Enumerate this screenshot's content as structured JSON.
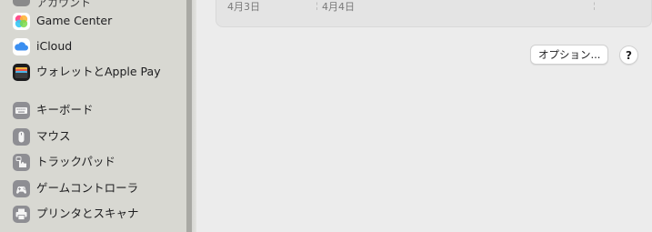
{
  "sidebar": {
    "partial_top_label": "アカウント",
    "items": [
      {
        "label": "Game Center",
        "icon": "game-center-icon"
      },
      {
        "label": "iCloud",
        "icon": "icloud-icon"
      },
      {
        "label": "ウォレットとApple Pay",
        "icon": "wallet-icon"
      },
      {
        "label": "キーボード",
        "icon": "keyboard-icon"
      },
      {
        "label": "マウス",
        "icon": "mouse-icon"
      },
      {
        "label": "トラックパッド",
        "icon": "trackpad-icon"
      },
      {
        "label": "ゲームコントローラ",
        "icon": "game-controller-icon"
      },
      {
        "label": "プリンタとスキャナ",
        "icon": "printer-icon"
      }
    ]
  },
  "content": {
    "dates": [
      "4月3日",
      "4月4日"
    ],
    "options_button": "オプション...",
    "help_button": "?"
  },
  "colors": {
    "sidebar_bg": "#d8d8d2",
    "content_bg": "#ececec",
    "icloud_blue": "#3a8ef0",
    "gray_icon": "#8e8e93"
  }
}
